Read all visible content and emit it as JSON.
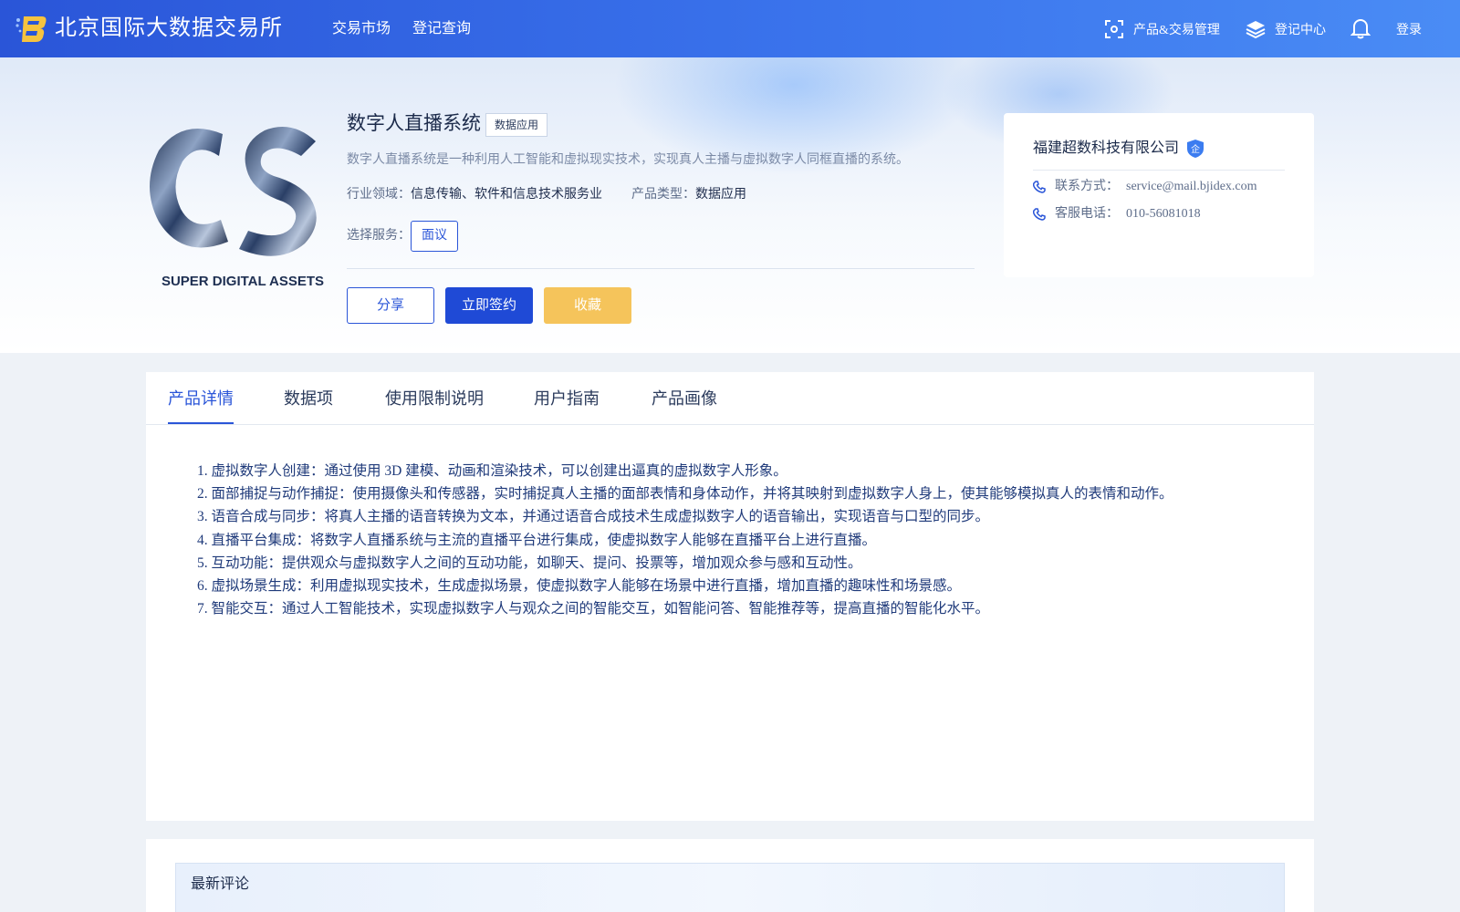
{
  "header": {
    "site_name": "北京国际大数据交易所",
    "nav": [
      "交易市场",
      "登记查询"
    ],
    "right_nav": {
      "product_mgmt": "产品&交易管理",
      "register_center": "登记中心",
      "login": "登录"
    }
  },
  "product": {
    "logo_caption": "SUPER DIGITAL ASSETS",
    "title": "数字人直播系统",
    "type_tag": "数据应用",
    "description": "数字人直播系统是一种利用人工智能和虚拟现实技术，实现真人主播与虚拟数字人同框直播的系统。",
    "industry_label": "行业领域：",
    "industry_value": "信息传输、软件和信息技术服务业",
    "product_type_label": "产品类型：",
    "product_type_value": "数据应用",
    "service_label": "选择服务：",
    "service_option": "面议",
    "actions": {
      "share": "分享",
      "sign": "立即签约",
      "favorite": "收藏"
    }
  },
  "company": {
    "name": "福建超数科技有限公司",
    "badge": "企",
    "contact_label": "联系方式：",
    "contact_value": "service@mail.bjidex.com",
    "phone_label": "客服电话：",
    "phone_value": "010-56081018"
  },
  "tabs": [
    "产品详情",
    "数据项",
    "使用限制说明",
    "用户指南",
    "产品画像"
  ],
  "active_tab": "产品详情",
  "features": [
    "1. 虚拟数字人创建：通过使用 3D 建模、动画和渲染技术，可以创建出逼真的虚拟数字人形象。",
    "2. 面部捕捉与动作捕捉：使用摄像头和传感器，实时捕捉真人主播的面部表情和身体动作，并将其映射到虚拟数字人身上，使其能够模拟真人的表情和动作。",
    "3. 语音合成与同步：将真人主播的语音转换为文本，并通过语音合成技术生成虚拟数字人的语音输出，实现语音与口型的同步。",
    "4. 直播平台集成：将数字人直播系统与主流的直播平台进行集成，使虚拟数字人能够在直播平台上进行直播。",
    "5. 互动功能：提供观众与虚拟数字人之间的互动功能，如聊天、提问、投票等，增加观众参与感和互动性。",
    "6. 虚拟场景生成：利用虚拟现实技术，生成虚拟场景，使虚拟数字人能够在场景中进行直播，增加直播的趣味性和场景感。",
    "7. 智能交互：通过人工智能技术，实现虚拟数字人与观众之间的智能交互，如智能问答、智能推荐等，提高直播的智能化水平。"
  ],
  "comments": {
    "title": "最新评论"
  },
  "colors": {
    "brand_blue": "#2a55d8",
    "favorite_yellow": "#f5c45b",
    "page_bg": "#eef2f7"
  },
  "icons": [
    "logo-mark",
    "scan-icon",
    "layers-icon",
    "bell-icon",
    "phone-icon",
    "enterprise-badge-icon"
  ]
}
